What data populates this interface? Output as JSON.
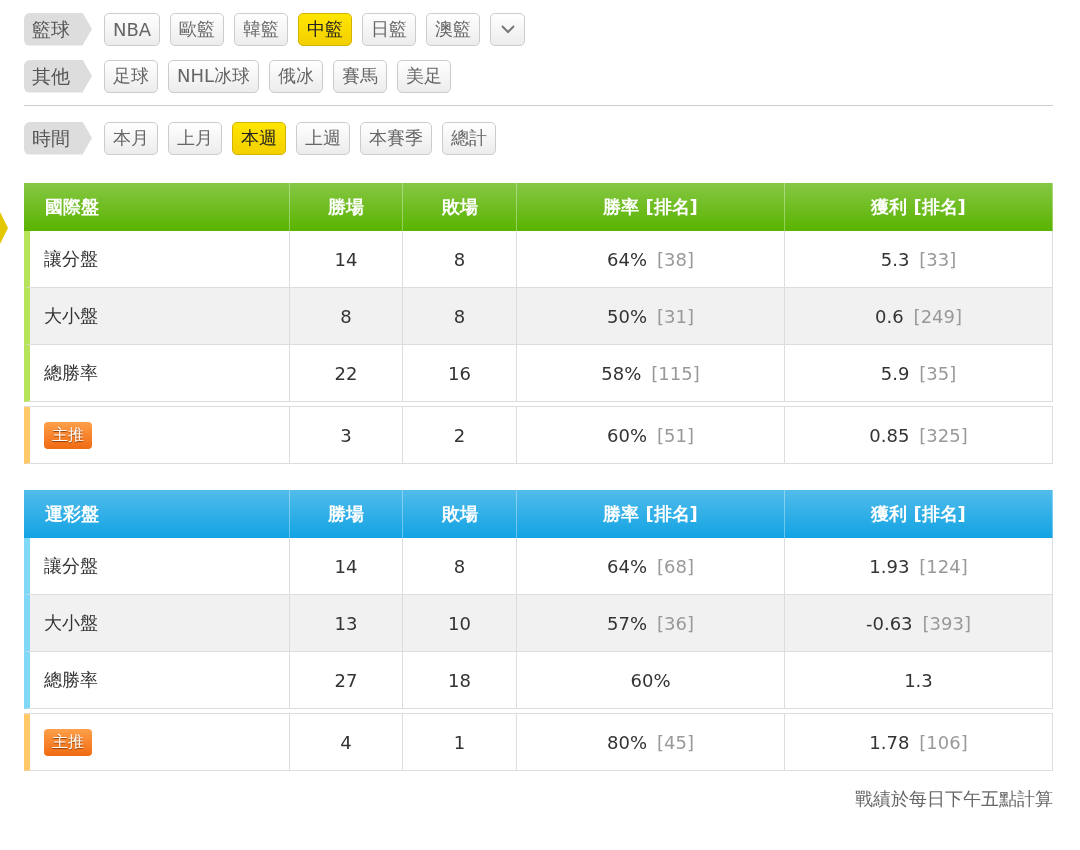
{
  "filters": [
    {
      "label": "籃球",
      "options": [
        {
          "label": "NBA",
          "selected": false
        },
        {
          "label": "歐籃",
          "selected": false
        },
        {
          "label": "韓籃",
          "selected": false
        },
        {
          "label": "中籃",
          "selected": true
        },
        {
          "label": "日籃",
          "selected": false
        },
        {
          "label": "澳籃",
          "selected": false
        }
      ],
      "more": true
    },
    {
      "label": "其他",
      "options": [
        {
          "label": "足球",
          "selected": false
        },
        {
          "label": "NHL冰球",
          "selected": false
        },
        {
          "label": "俄冰",
          "selected": false
        },
        {
          "label": "賽馬",
          "selected": false
        },
        {
          "label": "美足",
          "selected": false
        }
      ]
    },
    {
      "label": "時間",
      "options": [
        {
          "label": "本月",
          "selected": false
        },
        {
          "label": "上月",
          "selected": false
        },
        {
          "label": "本週",
          "selected": true
        },
        {
          "label": "上週",
          "selected": false
        },
        {
          "label": "本賽季",
          "selected": false
        },
        {
          "label": "總計",
          "selected": false
        }
      ]
    }
  ],
  "tables": [
    {
      "title": "國際盤",
      "color": "#5ab300",
      "columns": [
        "勝場",
        "敗場",
        "勝率 [排名]",
        "獲利 [排名]"
      ],
      "rows": [
        {
          "kind": "plain",
          "label": "讓分盤",
          "wins": "14",
          "losses": "8",
          "rate": "64%",
          "rate_rank": "[38]",
          "profit": "5.3",
          "profit_rank": "[33]"
        },
        {
          "kind": "plain",
          "label": "大小盤",
          "wins": "8",
          "losses": "8",
          "rate": "50%",
          "rate_rank": "[31]",
          "profit": "0.6",
          "profit_rank": "[249]"
        },
        {
          "kind": "plain",
          "label": "總勝率",
          "wins": "22",
          "losses": "16",
          "rate": "58%",
          "rate_rank": "[115]",
          "profit": "5.9",
          "profit_rank": "[35]"
        },
        {
          "kind": "pick",
          "label": "主推",
          "wins": "3",
          "losses": "2",
          "rate": "60%",
          "rate_rank": "[51]",
          "profit": "0.85",
          "profit_rank": "[325]"
        }
      ]
    },
    {
      "title": "運彩盤",
      "color": "#12a3e3",
      "columns": [
        "勝場",
        "敗場",
        "勝率 [排名]",
        "獲利 [排名]"
      ],
      "rows": [
        {
          "kind": "plain",
          "label": "讓分盤",
          "wins": "14",
          "losses": "8",
          "rate": "64%",
          "rate_rank": "[68]",
          "profit": "1.93",
          "profit_rank": "[124]"
        },
        {
          "kind": "plain",
          "label": "大小盤",
          "wins": "13",
          "losses": "10",
          "rate": "57%",
          "rate_rank": "[36]",
          "profit": "-0.63",
          "profit_rank": "[393]"
        },
        {
          "kind": "plain",
          "label": "總勝率",
          "wins": "27",
          "losses": "18",
          "rate": "60%",
          "profit": "1.3"
        },
        {
          "kind": "pick",
          "label": "主推",
          "wins": "4",
          "losses": "1",
          "rate": "80%",
          "rate_rank": "[45]",
          "profit": "1.78",
          "profit_rank": "[106]"
        }
      ]
    }
  ],
  "footnote": "戰績於每日下午五點計算"
}
